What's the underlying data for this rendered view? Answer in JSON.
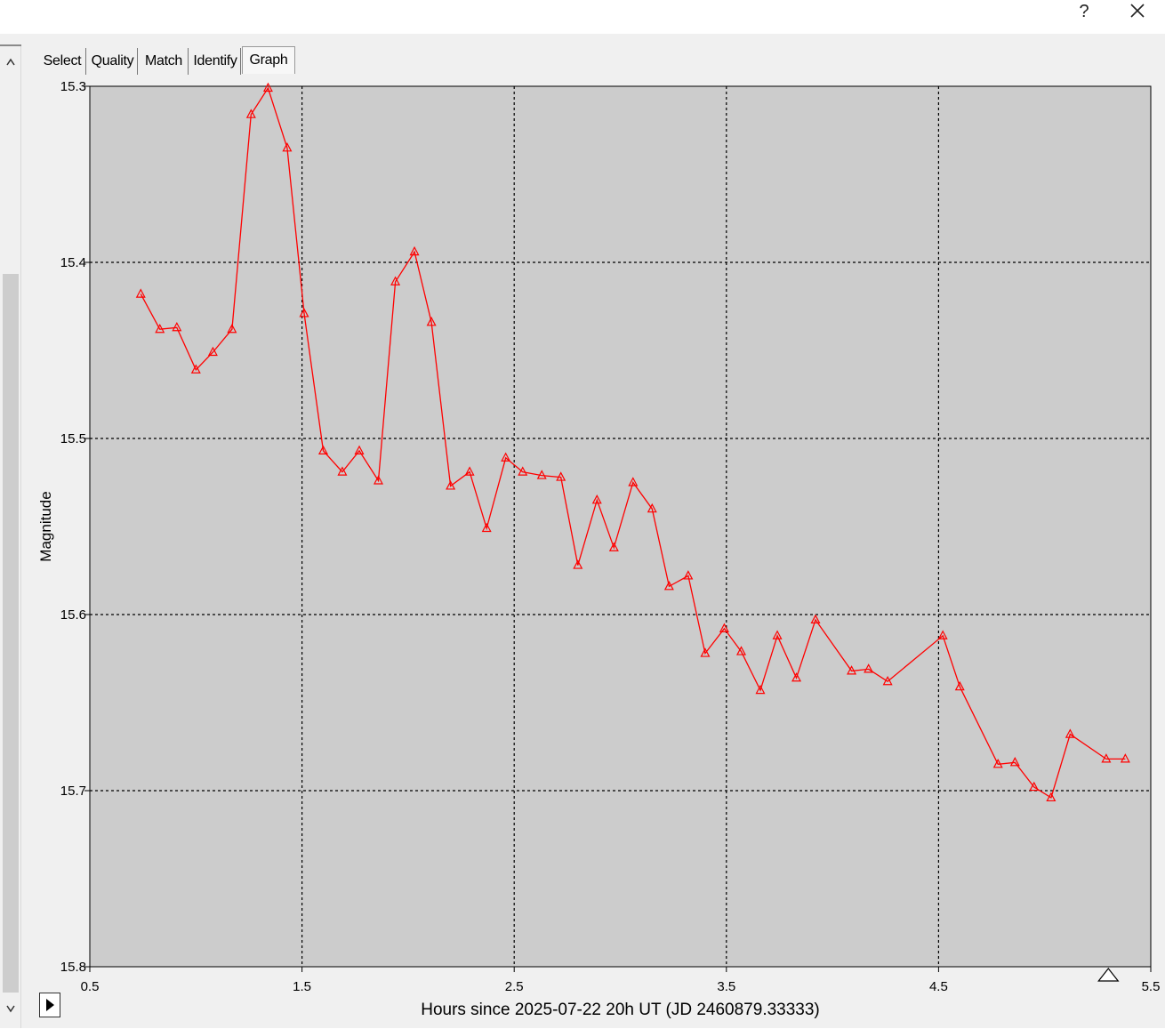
{
  "window": {
    "help_label": "?",
    "close_icon": "close-icon"
  },
  "tabs": [
    {
      "label": "Select",
      "active": false
    },
    {
      "label": "Quality",
      "active": false
    },
    {
      "label": "Match",
      "active": false
    },
    {
      "label": "Identify",
      "active": false
    },
    {
      "label": "Graph",
      "active": true
    }
  ],
  "scrollbar": {
    "up_icon": "chevron-up-icon",
    "down_icon": "chevron-down-icon"
  },
  "play_icon": "play-icon",
  "chart_data": {
    "type": "line",
    "xlabel": "Hours since 2025-07-22 20h UT (JD 2460879.33333)",
    "ylabel": "Magnitude",
    "xlim": [
      0.5,
      5.5
    ],
    "ylim": [
      15.3,
      15.8
    ],
    "y_inverted": true,
    "x_ticks": [
      "0.5",
      "1.5",
      "2.5",
      "3.5",
      "4.5",
      "5.5"
    ],
    "y_ticks": [
      "15.3",
      "15.4",
      "15.5",
      "15.6",
      "15.7",
      "15.8"
    ],
    "grid": true,
    "grid_style": "dashed",
    "plot_background": "#cccccc",
    "series": [
      {
        "color": "#ff0000",
        "marker": "triangle",
        "x": [
          0.74,
          0.83,
          0.91,
          1.0,
          1.08,
          1.17,
          1.26,
          1.34,
          1.43,
          1.51,
          1.6,
          1.69,
          1.77,
          1.86,
          1.94,
          2.03,
          2.11,
          2.2,
          2.29,
          2.37,
          2.46,
          2.54,
          2.63,
          2.72,
          2.8,
          2.89,
          2.97,
          3.06,
          3.15,
          3.23,
          3.32,
          3.4,
          3.49,
          3.57,
          3.66,
          3.74,
          3.83,
          3.92,
          4.09,
          4.17,
          4.26,
          4.52,
          4.6,
          4.78,
          4.86,
          4.95,
          5.03,
          5.12,
          5.29,
          5.38
        ],
        "y": [
          15.418,
          15.438,
          15.437,
          15.461,
          15.451,
          15.438,
          15.316,
          15.301,
          15.335,
          15.429,
          15.507,
          15.519,
          15.507,
          15.524,
          15.411,
          15.394,
          15.434,
          15.527,
          15.519,
          15.551,
          15.511,
          15.519,
          15.521,
          15.522,
          15.572,
          15.535,
          15.562,
          15.525,
          15.54,
          15.584,
          15.578,
          15.622,
          15.608,
          15.621,
          15.643,
          15.612,
          15.636,
          15.603,
          15.632,
          15.631,
          15.638,
          15.612,
          15.641,
          15.685,
          15.684,
          15.698,
          15.704,
          15.668,
          15.682,
          15.682
        ]
      }
    ],
    "marker_annotation_x": 5.3
  }
}
